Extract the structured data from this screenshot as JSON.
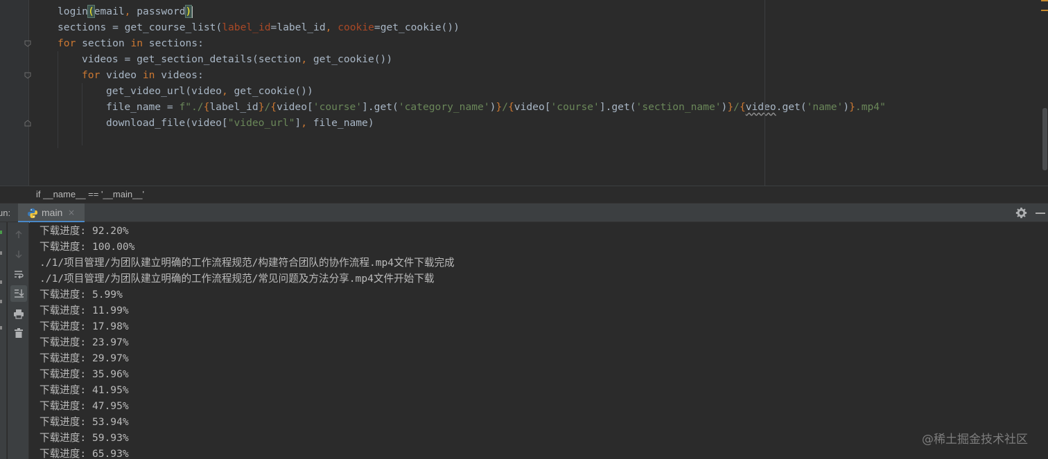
{
  "editor": {
    "lines": [
      [
        [
          "login",
          "def"
        ],
        [
          "(",
          "hlp"
        ],
        [
          "email",
          "def"
        ],
        [
          ", ",
          "sym"
        ],
        [
          "password",
          "def"
        ],
        [
          ")",
          "hlp"
        ],
        [
          "",
          "caret"
        ]
      ],
      [
        [
          "sections = get_course_list(",
          "def"
        ],
        [
          "label_id",
          "param"
        ],
        [
          "=label_id",
          "def"
        ],
        [
          ", ",
          "sym"
        ],
        [
          "cookie",
          "param"
        ],
        [
          "=get_cookie())",
          "def"
        ]
      ],
      [
        [
          "for",
          "kw"
        ],
        [
          " section ",
          "def"
        ],
        [
          "in",
          "kw"
        ],
        [
          " sections:",
          "def"
        ]
      ],
      [
        [
          "videos = get_section_details(section",
          "def"
        ],
        [
          ", ",
          "sym"
        ],
        [
          "get_cookie())",
          "def"
        ]
      ],
      [
        [
          "for",
          "kw"
        ],
        [
          " video ",
          "def"
        ],
        [
          "in",
          "kw"
        ],
        [
          " videos:",
          "def"
        ]
      ],
      [
        [
          "get_video_url(video",
          "def"
        ],
        [
          ", ",
          "sym"
        ],
        [
          "get_cookie())",
          "def"
        ]
      ],
      [
        [
          "file_name = ",
          "def"
        ],
        [
          "f\"./",
          "str"
        ],
        [
          "{",
          "sym"
        ],
        [
          "label_id",
          "def"
        ],
        [
          "}",
          "sym"
        ],
        [
          "/",
          "str"
        ],
        [
          "{",
          "sym"
        ],
        [
          "video[",
          "def"
        ],
        [
          "'course'",
          "str"
        ],
        [
          "].get(",
          "def"
        ],
        [
          "'category_name'",
          "str"
        ],
        [
          ")",
          "def"
        ],
        [
          "}",
          "sym"
        ],
        [
          "/",
          "str"
        ],
        [
          "{",
          "sym"
        ],
        [
          "video[",
          "def"
        ],
        [
          "'course'",
          "str"
        ],
        [
          "].get(",
          "def"
        ],
        [
          "'section_name'",
          "str"
        ],
        [
          ")",
          "def"
        ],
        [
          "}",
          "sym"
        ],
        [
          "/",
          "str"
        ],
        [
          "{",
          "sym"
        ],
        [
          "video",
          "sq"
        ],
        [
          ".get(",
          "def"
        ],
        [
          "'name'",
          "str"
        ],
        [
          ")",
          "def"
        ],
        [
          "}",
          "sym"
        ],
        [
          ".mp4\"",
          "str"
        ]
      ],
      [
        [
          "download_file(video[",
          "def"
        ],
        [
          "\"video_url\"",
          "str"
        ],
        [
          "]",
          "def"
        ],
        [
          ", ",
          "sym"
        ],
        [
          "file_name)",
          "def"
        ]
      ]
    ],
    "indent_levels": [
      0,
      0,
      0,
      1,
      1,
      2,
      2,
      2
    ]
  },
  "breadcrumb": "if __name__ == '__main__'",
  "run_panel": {
    "label": "un:",
    "tab_label": "main",
    "close_glyph": "×"
  },
  "console": {
    "lines": [
      "下载进度: 92.20%",
      "下载进度: 100.00%",
      "./1/项目管理/为团队建立明确的工作流程规范/构建符合团队的协作流程.mp4文件下载完成",
      "./1/项目管理/为团队建立明确的工作流程规范/常见问题及方法分享.mp4文件开始下载",
      "下载进度: 5.99%",
      "下载进度: 11.99%",
      "下载进度: 17.98%",
      "下载进度: 23.97%",
      "下载进度: 29.97%",
      "下载进度: 35.96%",
      "下载进度: 41.95%",
      "下载进度: 47.95%",
      "下载进度: 53.94%",
      "下载进度: 59.93%",
      "下载进度: 65.93%"
    ]
  },
  "watermark": "@稀土掘金技术社区",
  "icons": {
    "tool_buttons": [
      "arrow-up-icon",
      "arrow-down-icon",
      "soft-wrap-icon",
      "scroll-to-end-icon",
      "print-icon",
      "trash-icon"
    ],
    "tab_icon": "python-icon",
    "settings": "gear-icon",
    "hide": "minimize-icon"
  },
  "colors": {
    "keyword": "#cc7832",
    "string": "#6a8759",
    "param": "#aa4926",
    "text": "#a9b7c6",
    "console_text": "#bbbbbb",
    "background": "#2b2b2b",
    "tab_accent": "#4a88c7"
  }
}
